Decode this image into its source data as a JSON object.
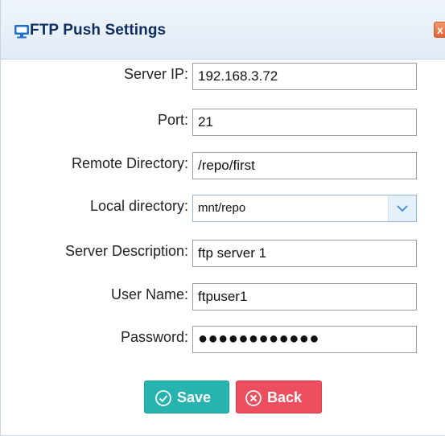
{
  "dialog": {
    "title": "FTP Push Settings",
    "close_label": "x",
    "close_color": "#e0623a"
  },
  "form": {
    "server_ip": {
      "label": "Server IP:",
      "value": "192.168.3.72"
    },
    "port": {
      "label": "Port:",
      "value": "21"
    },
    "remote_directory": {
      "label": "Remote Directory:",
      "value": "/repo/first"
    },
    "local_directory": {
      "label": "Local directory:",
      "value": "mnt/repo"
    },
    "server_description": {
      "label": "Server Description:",
      "value": "ftp server 1"
    },
    "user_name": {
      "label": "User Name:",
      "value": "ftpuser1"
    },
    "password": {
      "label": "Password:",
      "masked_value": "●●●●●●●●●●●●"
    }
  },
  "buttons": {
    "save_label": "Save",
    "back_label": "Back",
    "save_color": "#27b3b0",
    "back_color": "#ee4f5f"
  },
  "icons": {
    "title": "monitor-icon",
    "save": "check-circle-icon",
    "back": "x-circle-icon",
    "dropdown": "chevron-down-icon"
  }
}
